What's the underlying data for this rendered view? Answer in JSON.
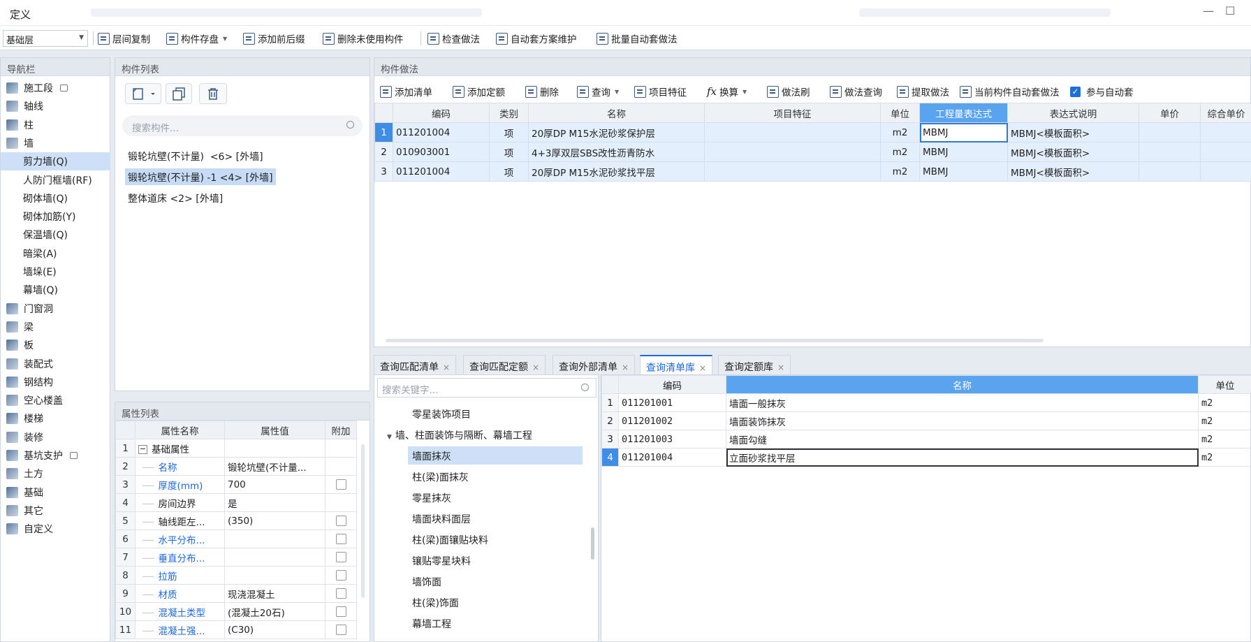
{
  "window": {
    "title": "定义",
    "minimize": "—",
    "maximize": "☐"
  },
  "toolbar": {
    "floor": "基础层",
    "items": [
      "层间复制",
      "构件存盘",
      "添加前后缀",
      "删除未使用构件",
      "检查做法",
      "自动套方案维护",
      "批量自动套做法"
    ]
  },
  "nav": {
    "title": "导航栏",
    "items": [
      {
        "label": "施工段",
        "icon": "segment-icon",
        "locked": true
      },
      {
        "label": "轴线",
        "icon": "grid-icon"
      },
      {
        "label": "柱",
        "icon": "column-icon"
      },
      {
        "label": "墙",
        "icon": "wall-icon"
      },
      {
        "label": "剪力墙(Q)",
        "sub": true,
        "selected": true
      },
      {
        "label": "人防门框墙(RF)",
        "sub": true
      },
      {
        "label": "砌体墙(Q)",
        "sub": true
      },
      {
        "label": "砌体加筋(Y)",
        "sub": true
      },
      {
        "label": "保温墙(Q)",
        "sub": true
      },
      {
        "label": "暗梁(A)",
        "sub": true
      },
      {
        "label": "墙垛(E)",
        "sub": true
      },
      {
        "label": "幕墙(Q)",
        "sub": true
      },
      {
        "label": "门窗洞",
        "icon": "door-window-icon"
      },
      {
        "label": "梁",
        "icon": "beam-icon"
      },
      {
        "label": "板",
        "icon": "slab-icon"
      },
      {
        "label": "装配式",
        "icon": "prefab-icon"
      },
      {
        "label": "钢结构",
        "icon": "steel-icon"
      },
      {
        "label": "空心楼盖",
        "icon": "hollow-floor-icon"
      },
      {
        "label": "楼梯",
        "icon": "stair-icon"
      },
      {
        "label": "装修",
        "icon": "decoration-icon"
      },
      {
        "label": "基坑支护",
        "icon": "pit-support-icon",
        "locked": true
      },
      {
        "label": "土方",
        "icon": "earthwork-icon"
      },
      {
        "label": "基础",
        "icon": "foundation-icon"
      },
      {
        "label": "其它",
        "icon": "other-icon"
      },
      {
        "label": "自定义",
        "icon": "custom-icon"
      }
    ]
  },
  "component_list": {
    "title": "构件列表",
    "search_placeholder": "搜索构件...",
    "items": [
      {
        "label": "锻轮坑壁(不计量)  <6> [外墙]"
      },
      {
        "label": "锻轮坑壁(不计量) -1 <4> [外墙]",
        "selected": true
      },
      {
        "label": "整体道床 <2> [外墙]"
      }
    ]
  },
  "properties": {
    "title": "属性列表",
    "headers": [
      "属性名称",
      "属性值",
      "附加"
    ],
    "rows": [
      {
        "idx": "1",
        "name": "基础属性",
        "value": "",
        "group": true
      },
      {
        "idx": "2",
        "name": "名称",
        "value": "锻轮坑壁(不计量...",
        "blue": true,
        "check": false
      },
      {
        "idx": "3",
        "name": "厚度(mm)",
        "value": "700",
        "blue": true,
        "check": true
      },
      {
        "idx": "4",
        "name": "房间边界",
        "value": "是",
        "blue": false,
        "check": false
      },
      {
        "idx": "5",
        "name": "轴线距左...",
        "value": "(350)",
        "blue": false,
        "check": true
      },
      {
        "idx": "6",
        "name": "水平分布...",
        "value": "",
        "blue": true,
        "check": true
      },
      {
        "idx": "7",
        "name": "垂直分布...",
        "value": "",
        "blue": true,
        "check": true
      },
      {
        "idx": "8",
        "name": "拉筋",
        "value": "",
        "blue": true,
        "check": true
      },
      {
        "idx": "9",
        "name": "材质",
        "value": "现浇混凝土",
        "blue": true,
        "check": true
      },
      {
        "idx": "10",
        "name": "混凝土类型",
        "value": "(混凝土20石)",
        "blue": true,
        "check": true
      },
      {
        "idx": "11",
        "name": "混凝土强...",
        "value": "(C30)",
        "blue": true,
        "check": true
      }
    ]
  },
  "method": {
    "title": "构件做法",
    "tools": [
      "添加清单",
      "添加定额",
      "删除",
      "查询",
      "项目特征",
      "换算",
      "做法刷",
      "做法查询",
      "提取做法",
      "当前构件自动套做法",
      "参与自动套"
    ],
    "headers": [
      "编码",
      "类别",
      "名称",
      "项目特征",
      "单位",
      "工程量表达式",
      "表达式说明",
      "单价",
      "综合单价"
    ],
    "rows": [
      {
        "idx": "1",
        "code": "011201004",
        "type": "项",
        "name": "20厚DP M15水泥砂浆保护层",
        "feature": "",
        "unit": "m2",
        "expr": "MBMJ",
        "desc": "MBMJ<模板面积>"
      },
      {
        "idx": "2",
        "code": "010903001",
        "type": "项",
        "name": "4+3厚双层SBS改性沥青防水",
        "feature": "",
        "unit": "m2",
        "expr": "MBMJ",
        "desc": "MBMJ<模板面积>"
      },
      {
        "idx": "3",
        "code": "011201004",
        "type": "项",
        "name": "20厚DP M15水泥砂浆找平层",
        "feature": "",
        "unit": "m2",
        "expr": "MBMJ",
        "desc": "MBMJ<模板面积>"
      }
    ]
  },
  "bottom_tabs": [
    "查询匹配清单",
    "查询匹配定额",
    "查询外部清单",
    "查询清单库",
    "查询定额库"
  ],
  "lib_tree": {
    "search_placeholder": "搜索关键字...",
    "items": [
      {
        "label": "零星装饰项目",
        "level": 2
      },
      {
        "label": "墙、柱面装饰与隔断、幕墙工程",
        "level": 1,
        "expanded": true
      },
      {
        "label": "墙面抹灰",
        "level": 2,
        "selected": true
      },
      {
        "label": "柱(梁)面抹灰",
        "level": 2
      },
      {
        "label": "零星抹灰",
        "level": 2
      },
      {
        "label": "墙面块料面层",
        "level": 2
      },
      {
        "label": "柱(梁)面镶贴块料",
        "level": 2
      },
      {
        "label": "镶贴零星块料",
        "level": 2
      },
      {
        "label": "墙饰面",
        "level": 2
      },
      {
        "label": "柱(梁)饰面",
        "level": 2
      },
      {
        "label": "幕墙工程",
        "level": 2
      }
    ]
  },
  "lib_table": {
    "headers": [
      "编码",
      "名称",
      "单位"
    ],
    "rows": [
      {
        "idx": "1",
        "code": "011201001",
        "name": "墙面一般抹灰",
        "unit": "m2"
      },
      {
        "idx": "2",
        "code": "011201002",
        "name": "墙面装饰抹灰",
        "unit": "m2"
      },
      {
        "idx": "3",
        "code": "011201003",
        "name": "墙面勾缝",
        "unit": "m2"
      },
      {
        "idx": "4",
        "code": "011201004",
        "name": "立面砂浆找平层",
        "unit": "m2"
      }
    ]
  },
  "colors": {
    "accent": "#1e68d6",
    "selection": "#cde0f7",
    "header_highlight": "#5aa3ee"
  }
}
